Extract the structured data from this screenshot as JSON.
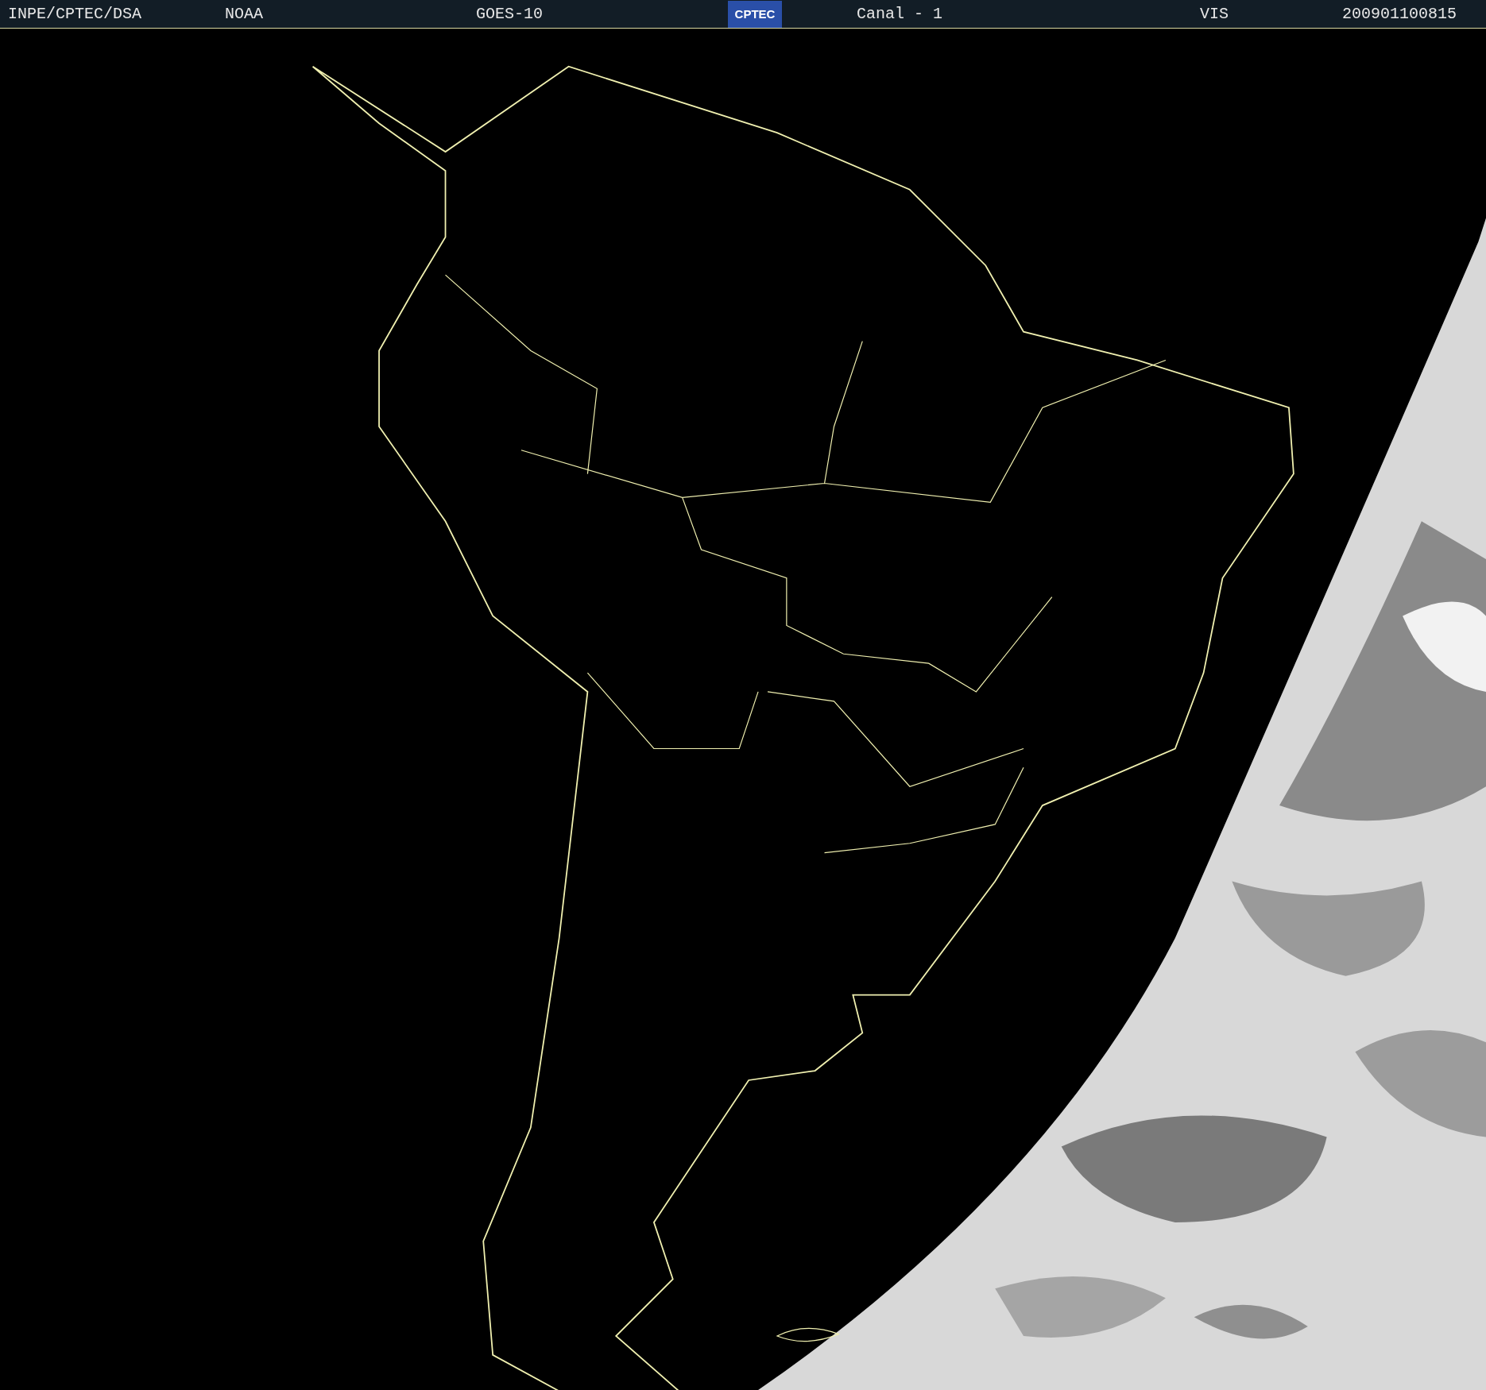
{
  "header": {
    "agency": "INPE/CPTEC/DSA",
    "source": "NOAA",
    "satellite": "GOES-10",
    "logo": "CPTEC",
    "channel": "Canal - 1",
    "band": "VIS",
    "timestamp": "200901100815"
  }
}
